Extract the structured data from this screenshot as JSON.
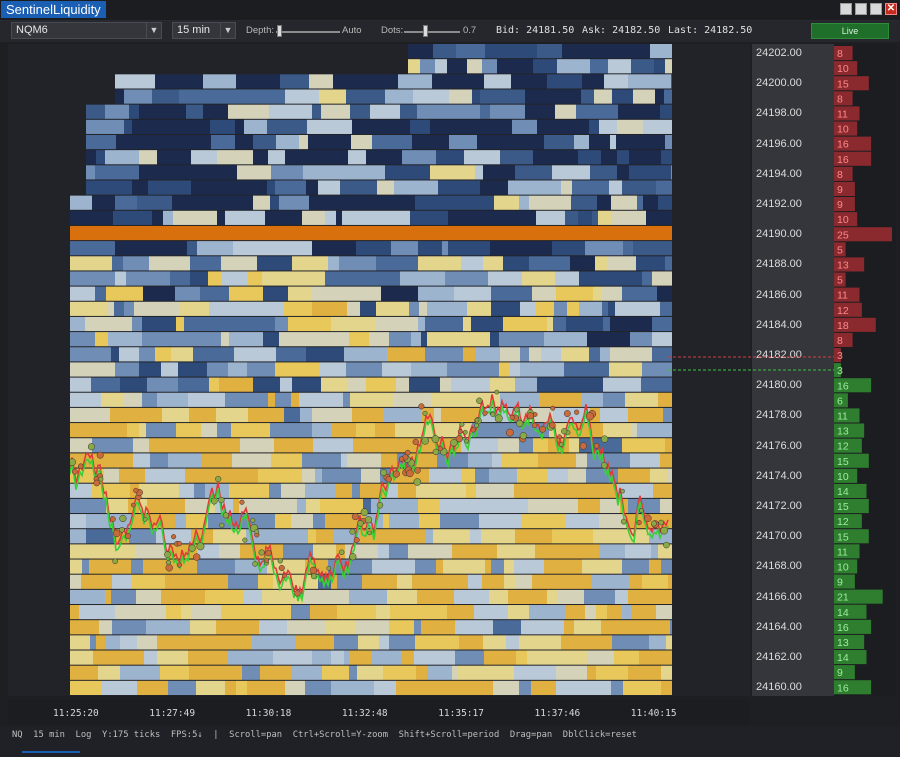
{
  "window": {
    "title": "SentinelLiquidity"
  },
  "toolbar": {
    "symbol": "NQM6",
    "interval": "15 min",
    "depth_label": "Depth:",
    "depth_value": "Auto",
    "dots_label": "Dots:",
    "dots_value": "0.7",
    "bid": "Bid: 24181.50",
    "ask": "Ask: 24182.50",
    "last": "Last: 24182.50",
    "live_label": "Live"
  },
  "price_axis": [
    "24202.00",
    "24200.00",
    "24198.00",
    "24196.00",
    "24194.00",
    "24192.00",
    "24190.00",
    "24188.00",
    "24186.00",
    "24184.00",
    "24182.00",
    "24180.00",
    "24178.00",
    "24176.00",
    "24174.00",
    "24172.00",
    "24170.00",
    "24168.00",
    "24166.00",
    "24164.00",
    "24162.00",
    "24160.00"
  ],
  "order_book": {
    "asks": [
      {
        "price": 24202.5,
        "size": "8"
      },
      {
        "price": 24201.75,
        "size": "10"
      },
      {
        "price": 24201.0,
        "size": "15"
      },
      {
        "price": 24200.25,
        "size": "8"
      },
      {
        "price": 24199.5,
        "size": "11"
      },
      {
        "price": 24198.75,
        "size": "10"
      },
      {
        "price": 24198.0,
        "size": "16"
      },
      {
        "price": 24197.25,
        "size": "16"
      },
      {
        "price": 24196.5,
        "size": "8"
      },
      {
        "price": 24195.75,
        "size": "9"
      },
      {
        "price": 24195.0,
        "size": "9"
      },
      {
        "price": 24194.25,
        "size": "10"
      },
      {
        "price": 24193.5,
        "size": "25"
      },
      {
        "price": 24192.75,
        "size": "5"
      },
      {
        "price": 24192.0,
        "size": "13"
      },
      {
        "price": 24191.25,
        "size": "5"
      },
      {
        "price": 24190.5,
        "size": "11"
      },
      {
        "price": 24189.75,
        "size": "12"
      },
      {
        "price": 24189.0,
        "size": "18"
      },
      {
        "price": 24188.25,
        "size": "8"
      },
      {
        "price": 24182.5,
        "size": "3"
      }
    ],
    "bids": [
      {
        "price": 24181.5,
        "size": "3"
      },
      {
        "price": 24180.5,
        "size": "16"
      },
      {
        "price": 24179.75,
        "size": "6"
      },
      {
        "price": 24179.0,
        "size": "11"
      },
      {
        "price": 24178.25,
        "size": "13"
      },
      {
        "price": 24177.5,
        "size": "12"
      },
      {
        "price": 24176.75,
        "size": "15"
      },
      {
        "price": 24176.0,
        "size": "10"
      },
      {
        "price": 24175.25,
        "size": "14"
      },
      {
        "price": 24174.5,
        "size": "15"
      },
      {
        "price": 24173.75,
        "size": "12"
      },
      {
        "price": 24173.0,
        "size": "15"
      },
      {
        "price": 24172.25,
        "size": "11"
      },
      {
        "price": 24171.5,
        "size": "10"
      },
      {
        "price": 24170.75,
        "size": "9"
      },
      {
        "price": 24170.0,
        "size": "21"
      },
      {
        "price": 24169.25,
        "size": "14"
      },
      {
        "price": 24168.5,
        "size": "16"
      },
      {
        "price": 24167.75,
        "size": "13"
      },
      {
        "price": 24167.0,
        "size": "14"
      },
      {
        "price": 24166.25,
        "size": "9"
      },
      {
        "price": 24165.5,
        "size": "16"
      }
    ]
  },
  "time_axis": [
    "11:25:20",
    "11:27:49",
    "11:30:18",
    "11:32:48",
    "11:35:17",
    "11:37:46",
    "11:40:15"
  ],
  "status": {
    "text": "NQ  15 min  Log  Y:175 ticks  FPS:5↓  |  Scroll=pan  Ctrl+Scroll=Y-zoom  Shift+Scroll=period  Drag=pan  DblClick=reset"
  },
  "colors": {
    "ask_bar": "#8a2a2e",
    "bid_bar": "#2f7d2f",
    "ask_text": "#ff8a8a",
    "bid_text": "#9af09a",
    "heat_low": "#1a2a4a",
    "heat_mid": "#9db4cf",
    "heat_high": "#e8c85a",
    "heat_peak": "#d8700e",
    "accent": "#1a5fb4"
  }
}
